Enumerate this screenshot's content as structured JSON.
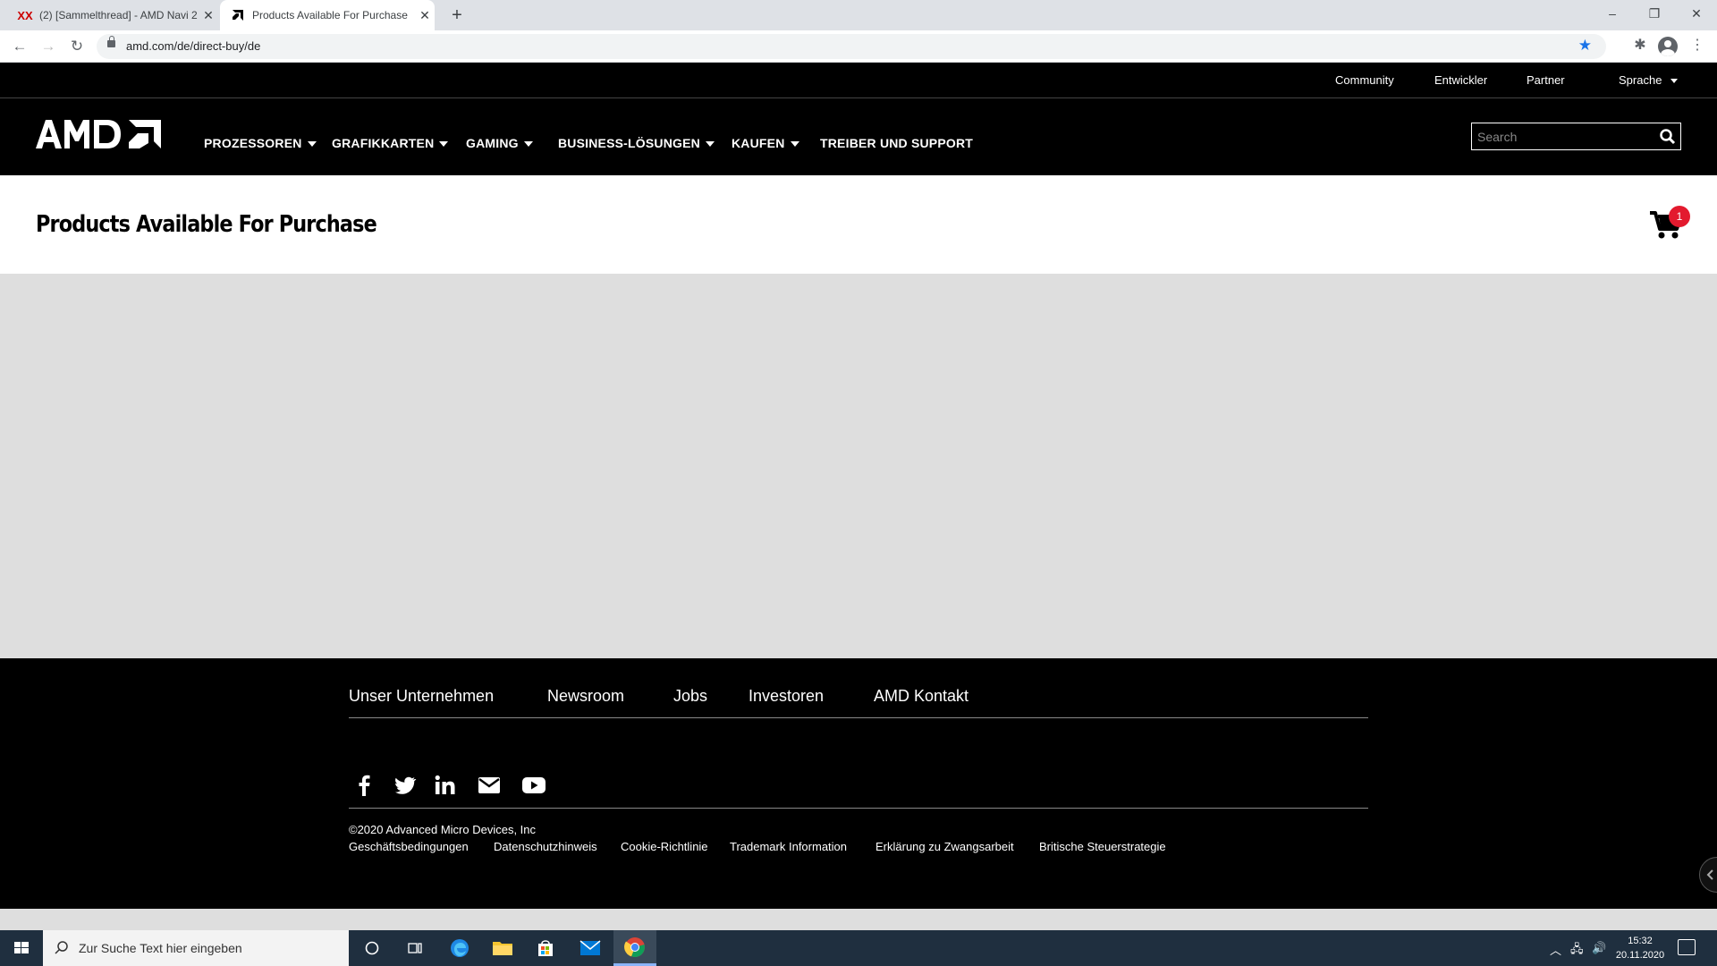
{
  "browser": {
    "tabs": [
      {
        "title": "(2) [Sammelthread] - AMD Navi 2",
        "favicon": "xx-icon"
      },
      {
        "title": "Products Available For Purchase",
        "favicon": "amd-icon"
      }
    ],
    "url": "amd.com/de/direct-buy/de"
  },
  "site": {
    "utility_links": [
      "Community",
      "Entwickler",
      "Partner",
      "Sprache"
    ],
    "nav": [
      "PROZESSOREN",
      "GRAFIKKARTEN",
      "GAMING",
      "BUSINESS-LÖSUNGEN",
      "KAUFEN",
      "TREIBER UND SUPPORT"
    ],
    "search_placeholder": "Search",
    "page_title": "Products Available For Purchase",
    "cart_count": "1"
  },
  "footer": {
    "links": [
      "Unser Unternehmen",
      "Newsroom",
      "Jobs",
      "Investoren",
      "AMD Kontakt"
    ],
    "social": [
      "facebook-icon",
      "twitter-icon",
      "linkedin-icon",
      "email-icon",
      "youtube-icon"
    ],
    "copyright": "©2020 Advanced Micro Devices, Inc",
    "legal": [
      "Geschäftsbedingungen",
      "Datenschutzhinweis",
      "Cookie-Richtlinie",
      "Trademark Information",
      "Erklärung zu Zwangsarbeit",
      "Britische Steuerstrategie"
    ]
  },
  "taskbar": {
    "search_placeholder": "Zur Suche Text hier eingeben",
    "time": "15:32",
    "date": "20.11.2020"
  },
  "colors": {
    "accent_red": "#e31a2e",
    "chrome_blue": "#1a73e8"
  }
}
